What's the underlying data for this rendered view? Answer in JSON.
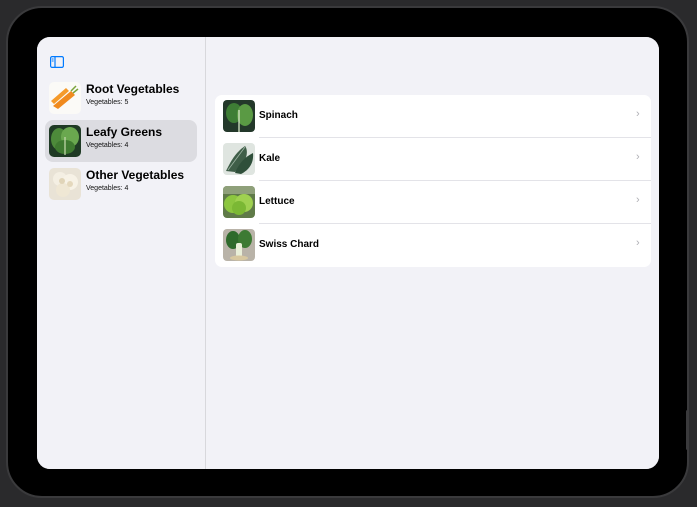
{
  "sidebar": {
    "categories": [
      {
        "title": "Root Vegetables",
        "subtitle": "Vegetables: 5",
        "selected": false
      },
      {
        "title": "Leafy Greens",
        "subtitle": "Vegetables: 4",
        "selected": true
      },
      {
        "title": "Other Vegetables",
        "subtitle": "Vegetables: 4",
        "selected": false
      }
    ]
  },
  "detail": {
    "items": [
      {
        "label": "Spinach"
      },
      {
        "label": "Kale"
      },
      {
        "label": "Lettuce"
      },
      {
        "label": "Swiss Chard"
      }
    ]
  },
  "icons": {
    "sidebar_toggle": "sidebar-left-icon",
    "row_disclosure": "chevron-right-icon"
  },
  "colors": {
    "accent": "#007aff",
    "selected_row": "#dcdce1",
    "background": "#f2f2f7"
  }
}
